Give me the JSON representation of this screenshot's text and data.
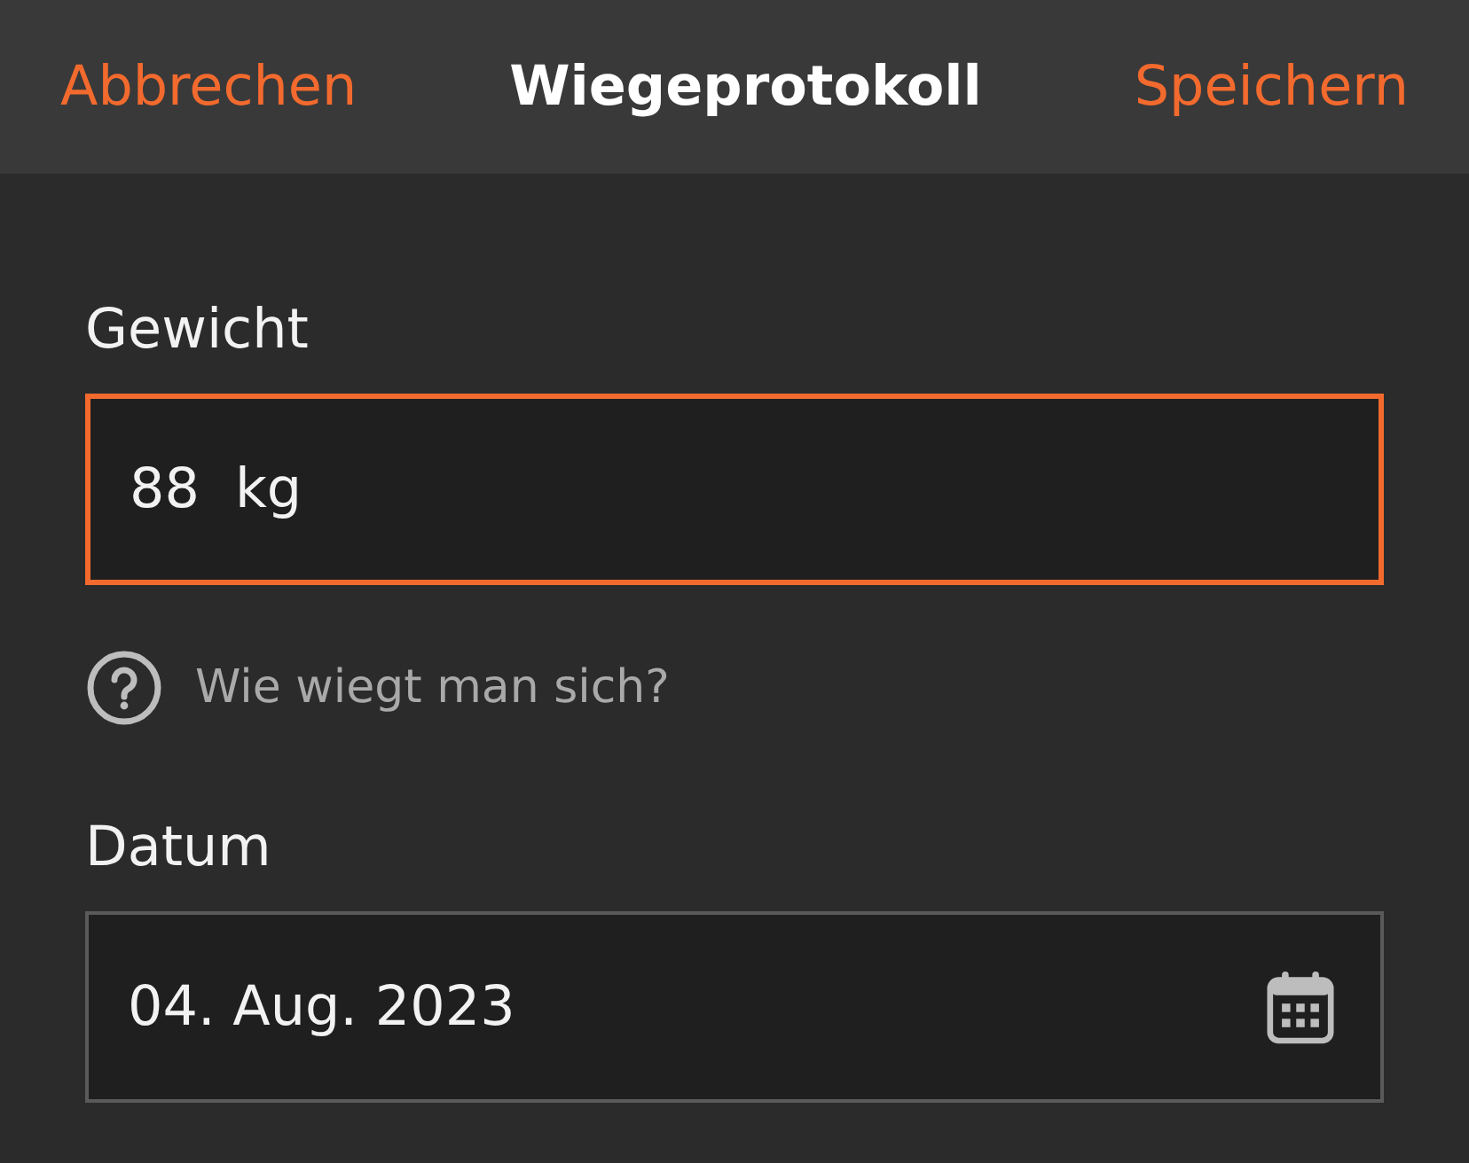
{
  "header": {
    "cancel": "Abbrechen",
    "title": "Wiegeprotokoll",
    "save": "Speichern"
  },
  "weight": {
    "label": "Gewicht",
    "value": "88",
    "unit": "kg",
    "focused": true
  },
  "help": {
    "text": "Wie wiegt man sich?"
  },
  "date": {
    "label": "Datum",
    "value": "04. Aug. 2023",
    "focused": false
  }
}
